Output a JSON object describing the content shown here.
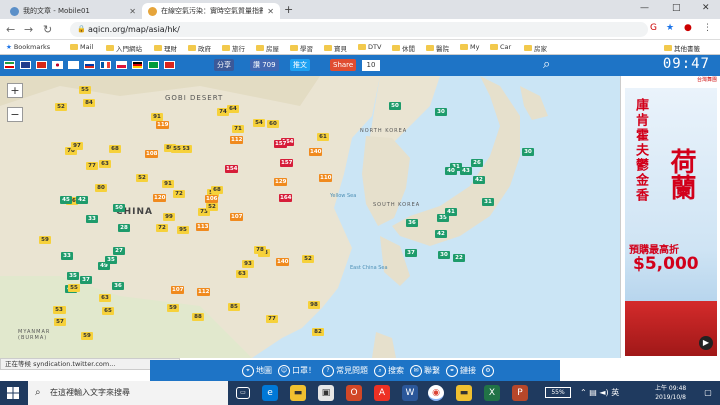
{
  "browser": {
    "tabs": [
      {
        "title": "我的文章 - Mobile01",
        "active": false
      },
      {
        "title": "在線空氣污染：實時空氣質量指數",
        "active": true
      }
    ],
    "new_tab": "+",
    "window_controls": {
      "minimize": "—",
      "maximize": "□",
      "close": "✕"
    },
    "url": "aqicn.org/map/asia/hk/",
    "bookmarks_label": "Bookmarks",
    "bookmarks": [
      "Mail",
      "入門網站",
      "理財",
      "政府",
      "旅行",
      "房屋",
      "學習",
      "寶貝",
      "DTV",
      "休閒",
      "醫院",
      "My",
      "Car",
      "房家"
    ],
    "other_bookmarks": "其他書籤"
  },
  "site": {
    "share_label": "分享",
    "like_label": "讚 709",
    "tweet_label": "推文",
    "share_btn": "Share",
    "share_count": "10",
    "clock": "09:47",
    "flags": [
      "#ddd",
      "#1f3c8c",
      "#d62718",
      "#fff",
      "#ffffff",
      "#0055a4",
      "#fff",
      "#d7141a",
      "#000",
      "#009c3b",
      "#da251d"
    ]
  },
  "map": {
    "zoom_in": "+",
    "zoom_out": "−",
    "fullscreen": "⛶",
    "labels": {
      "china": "CHINA",
      "korea": "SOUTH KOREA",
      "gobi": "GOBI DESERT",
      "north_korea": "NORTH KOREA",
      "myanmar": "MYANMAR\n(BURMA)",
      "yellow_sea": "Yellow Sea",
      "east_china_sea": "East China Sea"
    },
    "markers": [
      {
        "v": "95",
        "c": "y"
      },
      {
        "v": "70",
        "c": "y"
      },
      {
        "v": "99",
        "c": "y"
      },
      {
        "v": "82",
        "c": "y"
      },
      {
        "v": "57",
        "c": "y"
      },
      {
        "v": "112",
        "c": "o"
      },
      {
        "v": "64",
        "c": "y"
      },
      {
        "v": "53",
        "c": "y"
      },
      {
        "v": "71",
        "c": "y"
      },
      {
        "v": "73",
        "c": "y"
      },
      {
        "v": "84",
        "c": "y"
      },
      {
        "v": "82",
        "c": "y"
      },
      {
        "v": "56",
        "c": "y"
      },
      {
        "v": "61",
        "c": "y"
      },
      {
        "v": "72",
        "c": "y"
      },
      {
        "v": "129",
        "c": "o"
      },
      {
        "v": "59",
        "c": "y"
      },
      {
        "v": "80",
        "c": "y"
      },
      {
        "v": "157",
        "c": "r"
      },
      {
        "v": "107",
        "c": "o"
      },
      {
        "v": "52",
        "c": "y"
      },
      {
        "v": "57",
        "c": "y"
      },
      {
        "v": "65",
        "c": "y"
      },
      {
        "v": "55",
        "c": "y"
      },
      {
        "v": "68",
        "c": "y"
      },
      {
        "v": "68",
        "c": "y"
      },
      {
        "v": "97",
        "c": "y"
      },
      {
        "v": "112",
        "c": "o"
      },
      {
        "v": "154",
        "c": "r"
      },
      {
        "v": "140",
        "c": "o"
      },
      {
        "v": "30",
        "c": "g"
      },
      {
        "v": "33",
        "c": "g"
      },
      {
        "v": "42",
        "c": "g"
      },
      {
        "v": "107",
        "c": "o"
      },
      {
        "v": "68",
        "c": "y"
      },
      {
        "v": "54",
        "c": "y"
      },
      {
        "v": "36",
        "c": "g"
      },
      {
        "v": "36",
        "c": "g"
      },
      {
        "v": "98",
        "c": "y"
      },
      {
        "v": "78",
        "c": "y"
      },
      {
        "v": "164",
        "c": "r"
      },
      {
        "v": "106",
        "c": "o"
      },
      {
        "v": "80",
        "c": "y"
      },
      {
        "v": "63",
        "c": "y"
      },
      {
        "v": "37",
        "c": "g"
      },
      {
        "v": "45",
        "c": "g"
      },
      {
        "v": "43",
        "c": "g"
      },
      {
        "v": "46",
        "c": "g"
      },
      {
        "v": "59",
        "c": "y"
      },
      {
        "v": "52",
        "c": "y"
      },
      {
        "v": "55",
        "c": "y"
      },
      {
        "v": "110",
        "c": "o"
      },
      {
        "v": "108",
        "c": "o"
      },
      {
        "v": "93",
        "c": "y"
      },
      {
        "v": "85",
        "c": "y"
      },
      {
        "v": "63",
        "c": "y"
      },
      {
        "v": "50",
        "c": "g"
      },
      {
        "v": "119",
        "c": "o"
      },
      {
        "v": "164",
        "c": "r"
      },
      {
        "v": "140",
        "c": "o"
      },
      {
        "v": "157",
        "c": "r"
      },
      {
        "v": "113",
        "c": "o"
      },
      {
        "v": "120",
        "c": "o"
      },
      {
        "v": "63",
        "c": "y"
      },
      {
        "v": "60",
        "c": "y"
      },
      {
        "v": "55",
        "c": "y"
      },
      {
        "v": "74",
        "c": "y"
      },
      {
        "v": "91",
        "c": "y"
      },
      {
        "v": "72",
        "c": "y"
      },
      {
        "v": "33",
        "c": "g"
      },
      {
        "v": "35",
        "c": "g"
      },
      {
        "v": "37",
        "c": "g"
      },
      {
        "v": "31",
        "c": "g"
      },
      {
        "v": "42",
        "c": "g"
      },
      {
        "v": "53",
        "c": "y"
      },
      {
        "v": "52",
        "c": "y"
      },
      {
        "v": "77",
        "c": "y"
      },
      {
        "v": "59",
        "c": "y"
      },
      {
        "v": "91",
        "c": "y"
      },
      {
        "v": "88",
        "c": "y"
      },
      {
        "v": "31",
        "c": "g"
      },
      {
        "v": "35",
        "c": "g"
      },
      {
        "v": "42",
        "c": "g"
      },
      {
        "v": "52",
        "c": "y"
      },
      {
        "v": "30",
        "c": "g"
      },
      {
        "v": "50",
        "c": "g"
      },
      {
        "v": "41",
        "c": "g"
      },
      {
        "v": "77",
        "c": "y"
      },
      {
        "v": "22",
        "c": "g"
      },
      {
        "v": "49",
        "c": "g"
      },
      {
        "v": "30",
        "c": "g"
      },
      {
        "v": "28",
        "c": "g"
      },
      {
        "v": "26",
        "c": "g"
      },
      {
        "v": "35",
        "c": "g"
      },
      {
        "v": "40",
        "c": "g"
      },
      {
        "v": "27",
        "c": "g"
      }
    ]
  },
  "ad": {
    "top": "台灣舞團",
    "line1": "庫肯霍夫鬱金香",
    "line2": "荷蘭",
    "line3": "預購最高折",
    "price": "$5,000"
  },
  "status_bar": "正在等候 syndication.twitter.com...",
  "bottom_nav": [
    {
      "icon": "⌖",
      "label": "地圖"
    },
    {
      "icon": "☺",
      "label": "口罩！"
    },
    {
      "icon": "?",
      "label": "常見問題"
    },
    {
      "icon": "⌕",
      "label": "搜索"
    },
    {
      "icon": "✉",
      "label": "聯繫"
    },
    {
      "icon": "⚭",
      "label": "鏈接"
    },
    {
      "icon": "⚙",
      "label": ""
    }
  ],
  "taskbar": {
    "search_placeholder": "在這裡輸入文字來搜尋",
    "battery": "55%",
    "ime": "英",
    "time": "上午 09:48",
    "date": "2019/10/8"
  }
}
